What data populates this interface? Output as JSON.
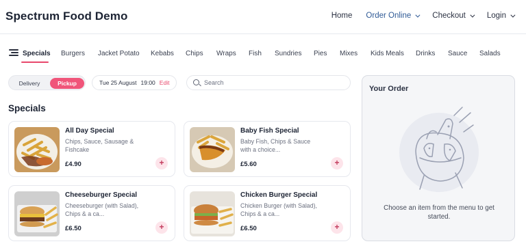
{
  "header": {
    "brand": "Spectrum Food Demo",
    "nav": [
      {
        "label": "Home"
      },
      {
        "label": "Order Online"
      },
      {
        "label": "Checkout"
      },
      {
        "label": "Login"
      }
    ]
  },
  "categories": [
    "Specials",
    "Burgers",
    "Jacket Potato",
    "Kebabs",
    "Chips",
    "Wraps",
    "Fish",
    "Sundries",
    "Pies",
    "Mixes",
    "Kids Meals",
    "Drinks",
    "Sauce",
    "Salads"
  ],
  "controls": {
    "delivery_label": "Delivery",
    "pickup_label": "Pickup",
    "date": "Tue 25 August",
    "time": "19:00",
    "edit_label": "Edit",
    "search_placeholder": "Search"
  },
  "section_title": "Specials",
  "items": [
    {
      "title": "All Day Special",
      "desc": "Chips, Sauce, Sausage & Fishcake",
      "price": "£4.90"
    },
    {
      "title": "Baby Fish Special",
      "desc": "Baby Fish, Chips & Sauce with a choice...",
      "price": "£5.60"
    },
    {
      "title": "Cheeseburger Special",
      "desc": "Cheeseburger (with Salad), Chips & a ca...",
      "price": "£6.50"
    },
    {
      "title": "Chicken Burger Special",
      "desc": "Chicken Burger (with Salad), Chips & a ca...",
      "price": "£6.50"
    }
  ],
  "add_symbol": "+",
  "order": {
    "title": "Your Order",
    "empty_text": "Choose an item from the menu to get started."
  },
  "colors": {
    "accent": "#f0557a",
    "nav_active": "#2f5a96"
  }
}
